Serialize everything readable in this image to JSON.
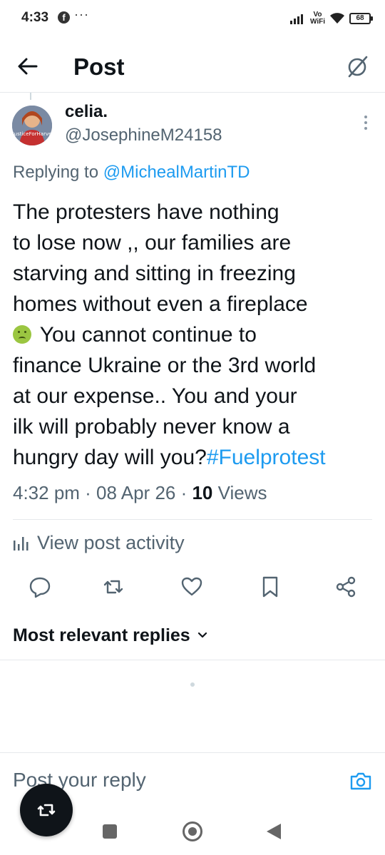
{
  "status_bar": {
    "time": "4:33",
    "vowifi_top": "Vo",
    "vowifi_bottom": "WiFi",
    "battery": "68"
  },
  "header": {
    "title": "Post"
  },
  "tweet": {
    "author_name": "celia.",
    "author_handle": "@JosephineM24158",
    "avatar_text": "JusticeForHarve",
    "replying_prefix": "Replying to ",
    "replying_to": "@MichealMartinTD",
    "text_lines": [
      "The protesters have nothing",
      "to lose now ,, our families are",
      "starving and sitting in freezing",
      "homes without even a fireplace",
      " You cannot continue to",
      "finance Ukraine or the 3rd world",
      "at our expense.. You and your",
      "ilk will probably never know a",
      "hungry day will you?"
    ],
    "hashtag": "#Fuelprotest",
    "timestamp": "4:32 pm · 08 Apr 26 · ",
    "views_count": "10",
    "views_label": " Views",
    "activity_label": "View post activity"
  },
  "actions": [
    "reply",
    "repost",
    "like",
    "bookmark",
    "share"
  ],
  "replies": {
    "sort_label": "Most relevant replies"
  },
  "reply_bar": {
    "placeholder": "Post your reply"
  },
  "colors": {
    "accent": "#1d9bf0",
    "text": "#0f1419",
    "secondary": "#536471",
    "divider": "#e6e9ec"
  }
}
